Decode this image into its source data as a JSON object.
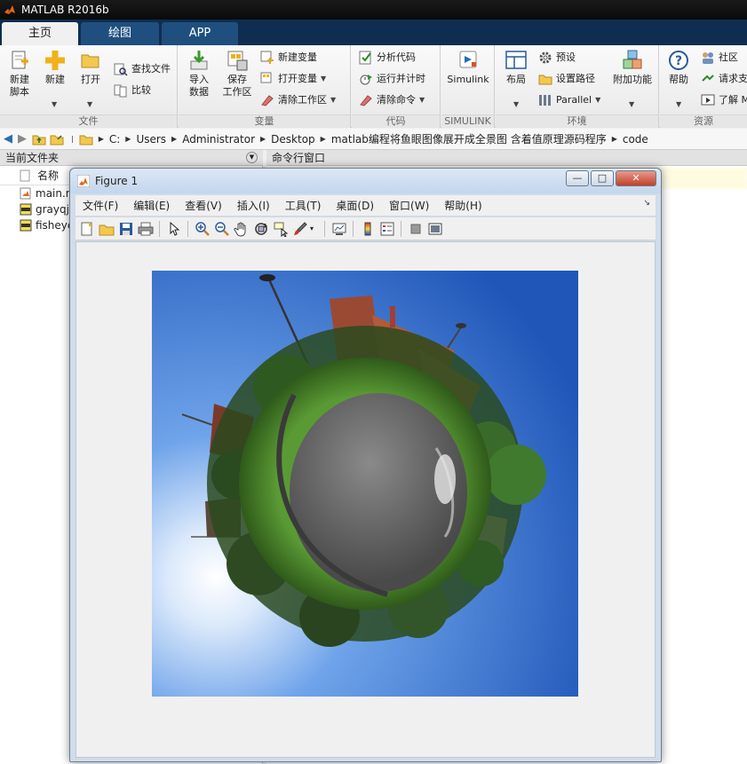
{
  "app": {
    "title": "MATLAB R2016b"
  },
  "tabs": [
    {
      "label": "主页",
      "active": true
    },
    {
      "label": "绘图",
      "active": false
    },
    {
      "label": "APP",
      "active": false
    }
  ],
  "ribbon": {
    "file": {
      "label": "文件",
      "new_script": "新建\n脚本",
      "new": "新建",
      "open": "打开",
      "find_files": "查找文件",
      "compare": "比较"
    },
    "variable": {
      "label": "变量",
      "import": "导入\n数据",
      "save_workspace": "保存\n工作区",
      "new_variable": "新建变量",
      "open_variable": "打开变量",
      "clear_workspace": "清除工作区"
    },
    "code": {
      "label": "代码",
      "analyze": "分析代码",
      "run_time": "运行并计时",
      "clear_commands": "清除命令"
    },
    "simulink": {
      "label": "SIMULINK",
      "simulink": "Simulink"
    },
    "environment": {
      "label": "环境",
      "layout": "布局",
      "preferences": "预设",
      "set_path": "设置路径",
      "parallel": "Parallel",
      "addons": "附加功能"
    },
    "resources": {
      "label": "资源",
      "help": "帮助",
      "community": "社区",
      "request_support": "请求支",
      "learn": "了解 M"
    }
  },
  "address": {
    "crumbs": [
      "C:",
      "Users",
      "Administrator",
      "Desktop",
      "matlab编程将鱼眼图像展开成全景图 含着值原理源码程序",
      "code"
    ]
  },
  "current_folder": {
    "title": "当前文件夹",
    "column_name": "名称",
    "files": [
      {
        "name": "main.m",
        "icon": "m-file-icon"
      },
      {
        "name": "grayqj",
        "icon": "jpg-file-icon"
      },
      {
        "name": "fisheye",
        "icon": "jpg-file-icon"
      }
    ]
  },
  "command_window": {
    "title": "命令行窗口"
  },
  "figure": {
    "title": "Figure 1",
    "menu": [
      "文件(F)",
      "编辑(E)",
      "查看(V)",
      "插入(I)",
      "工具(T)",
      "桌面(D)",
      "窗口(W)",
      "帮助(H)"
    ],
    "window_buttons": {
      "minimize": "—",
      "maximize": "□",
      "close": "✕"
    }
  },
  "colors": {
    "titlebar": "#0a0a0a",
    "tabstrip": "#0f2d50",
    "tab_inactive": "#1f4f7e",
    "sky": "#2f6fd0",
    "grass": "#4f8a2e",
    "road": "#6a6a6a"
  }
}
